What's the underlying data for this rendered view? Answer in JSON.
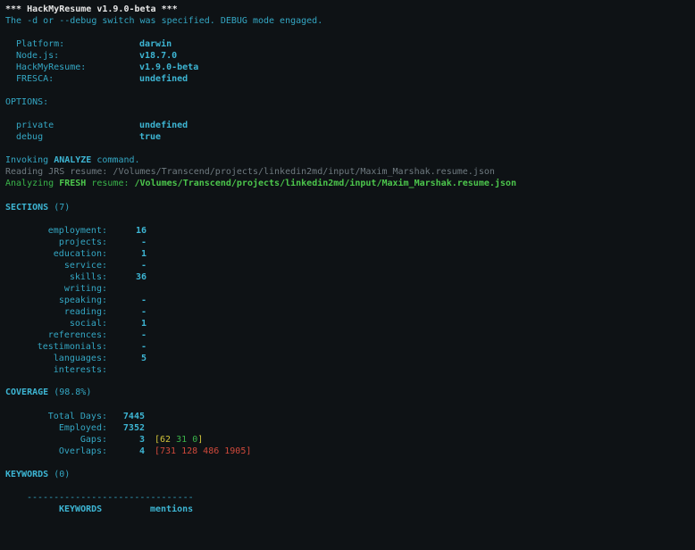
{
  "title": "*** HackMyResume v1.9.0-beta ***",
  "debug_msg": "The -d or --debug switch was specified. DEBUG mode engaged.",
  "env": [
    {
      "label": "Platform:",
      "value": "darwin"
    },
    {
      "label": "Node.js:",
      "value": "v18.7.0"
    },
    {
      "label": "HackMyResume:",
      "value": "v1.9.0-beta"
    },
    {
      "label": "FRESCA:",
      "value": "undefined"
    }
  ],
  "options_header": "OPTIONS:",
  "options": [
    {
      "label": "private",
      "value": "undefined"
    },
    {
      "label": "debug",
      "value": "true"
    }
  ],
  "invoke": {
    "prefix": "Invoking ",
    "cmd": "ANALYZE",
    "suffix": " command."
  },
  "reading": {
    "prefix": "Reading ",
    "fmt": "JRS",
    "mid": " resume: ",
    "path": "/Volumes/Transcend/projects/linkedin2md/input/Maxim_Marshak.resume.json"
  },
  "analyzing": {
    "prefix": "Analyzing ",
    "fmt": "FRESH",
    "mid": " resume: ",
    "path": "/Volumes/Transcend/projects/linkedin2md/input/Maxim_Marshak.resume.json"
  },
  "sections": {
    "header": "SECTIONS",
    "count": "(7)",
    "rows": [
      {
        "label": "employment:",
        "value": "16"
      },
      {
        "label": "projects:",
        "value": "-"
      },
      {
        "label": "education:",
        "value": "1"
      },
      {
        "label": "service:",
        "value": "-"
      },
      {
        "label": "skills:",
        "value": "36"
      },
      {
        "label": "writing:",
        "value": ""
      },
      {
        "label": "speaking:",
        "value": "-"
      },
      {
        "label": "reading:",
        "value": "-"
      },
      {
        "label": "social:",
        "value": "1"
      },
      {
        "label": "references:",
        "value": "-"
      },
      {
        "label": "testimonials:",
        "value": "-"
      },
      {
        "label": "languages:",
        "value": "5"
      },
      {
        "label": "interests:",
        "value": ""
      }
    ]
  },
  "coverage": {
    "header": "COVERAGE",
    "pct": "(98.8%)",
    "total_days_label": "Total Days:",
    "total_days": "7445",
    "employed_label": "Employed:",
    "employed": "7352",
    "gaps_label": "Gaps:",
    "gaps": "3",
    "gaps_detail": {
      "open": "[",
      "values": [
        "62",
        "31",
        "0"
      ],
      "close": "]"
    },
    "overlaps_label": "Overlaps:",
    "overlaps": "4",
    "overlaps_detail": "[731 128 486 1905]"
  },
  "keywords": {
    "header": "KEYWORDS",
    "count": "(0)",
    "divider": "-------------------------------",
    "col_keywords": "KEYWORDS",
    "col_mentions": "mentions"
  },
  "colors": {
    "background": "#0e1215",
    "cyan": "#34a7c4",
    "white": "#e6e6e6",
    "grey": "#6f7a80",
    "green": "#3ab54a",
    "yellow": "#d2c43a",
    "red": "#d0493b"
  }
}
